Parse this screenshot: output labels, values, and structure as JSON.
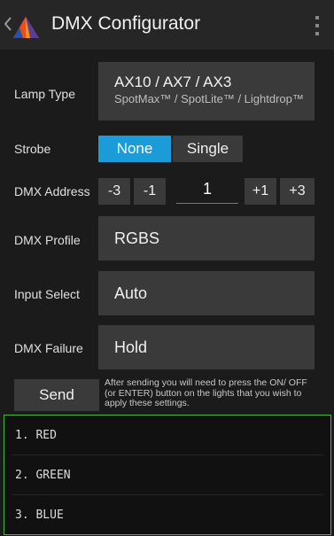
{
  "app": {
    "title": "DMX Configurator"
  },
  "lamp_type": {
    "label": "Lamp Type",
    "primary": "AX10 / AX7 / AX3",
    "secondary": "SpotMax™ / SpotLite™ / Lightdrop™"
  },
  "strobe": {
    "label": "Strobe",
    "options": [
      "None",
      "Single"
    ],
    "selected": "None"
  },
  "dmx_address": {
    "label": "DMX Address",
    "minus3": "-3",
    "minus1": "-1",
    "value": "1",
    "plus1": "+1",
    "plus3": "+3"
  },
  "dmx_profile": {
    "label": "DMX Profile",
    "value": "RGBS"
  },
  "input_select": {
    "label": "Input Select",
    "value": "Auto"
  },
  "dmx_failure": {
    "label": "DMX Failure",
    "value": "Hold"
  },
  "send": {
    "label": "Send",
    "note": "After sending you will need to press the ON/ OFF (or ENTER) button on the lights that you wish to apply these settings."
  },
  "channels": [
    "1. RED",
    "2. GREEN",
    "3. BLUE"
  ],
  "colors": {
    "accent": "#1b9bd7",
    "list_border": "#4bb543"
  }
}
